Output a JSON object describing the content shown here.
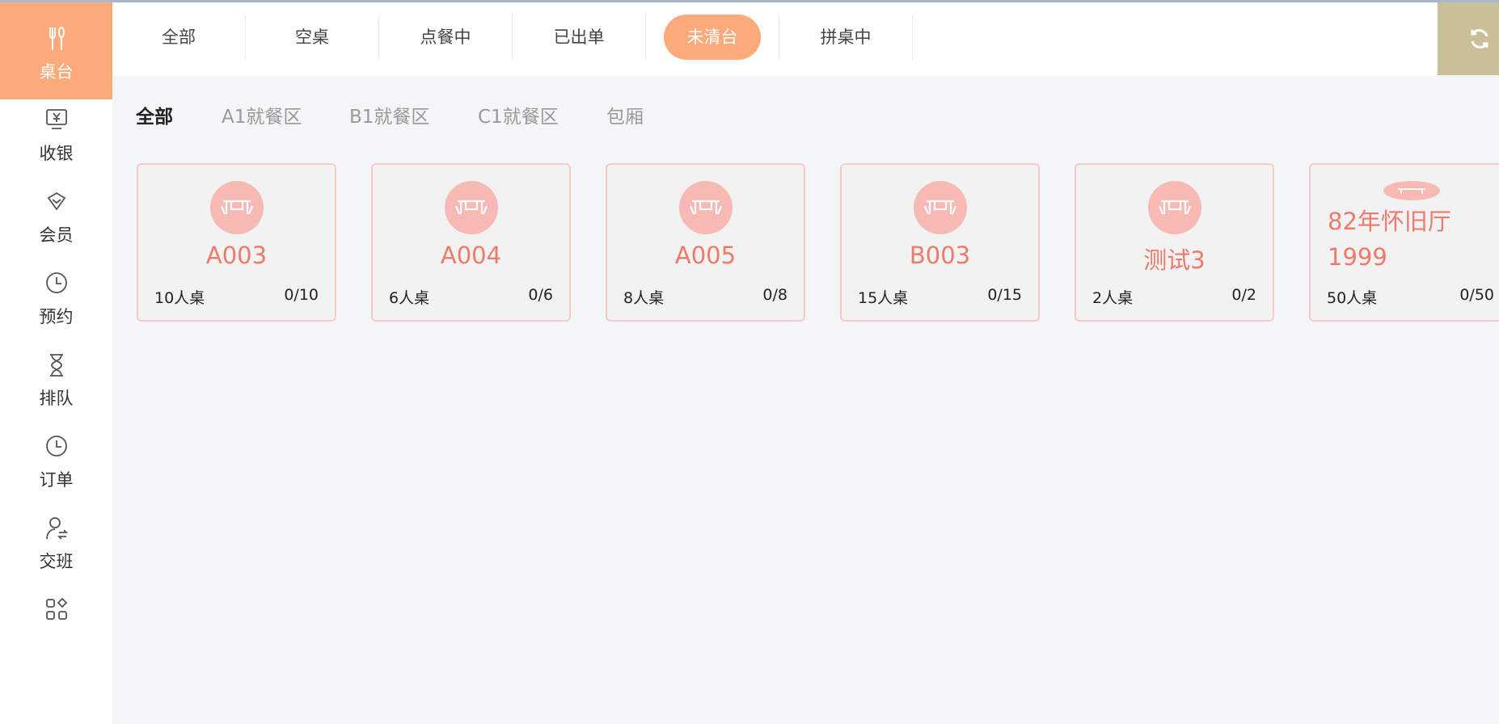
{
  "sidebar": {
    "items": [
      {
        "label": "桌台",
        "icon": "fork-knife-icon"
      },
      {
        "label": "收银",
        "icon": "cashier-icon"
      },
      {
        "label": "会员",
        "icon": "diamond-icon"
      },
      {
        "label": "预约",
        "icon": "clock-icon"
      },
      {
        "label": "排队",
        "icon": "hourglass-icon"
      },
      {
        "label": "订单",
        "icon": "clock-icon"
      },
      {
        "label": "交班",
        "icon": "user-swap-icon"
      },
      {
        "label": "",
        "icon": "apps-icon"
      }
    ]
  },
  "filters": [
    "全部",
    "空桌",
    "点餐中",
    "已出单",
    "未清台",
    "拼桌中"
  ],
  "active_filter": "未清台",
  "refresh_icon": "refresh-icon",
  "areas": [
    "全部",
    "A1就餐区",
    "B1就餐区",
    "C1就餐区",
    "包厢"
  ],
  "active_area": "全部",
  "tables": [
    {
      "name": "A003",
      "capacity": "10人桌",
      "occupancy": "0/10"
    },
    {
      "name": "A004",
      "capacity": "6人桌",
      "occupancy": "0/6"
    },
    {
      "name": "A005",
      "capacity": "8人桌",
      "occupancy": "0/8"
    },
    {
      "name": "B003",
      "capacity": "15人桌",
      "occupancy": "0/15"
    },
    {
      "name": "测试3",
      "capacity": "2人桌",
      "occupancy": "0/2"
    },
    {
      "name": "82年怀旧厅1999",
      "capacity": "50人桌",
      "occupancy": "0/50"
    }
  ],
  "colors": {
    "accent": "#fdaa7a",
    "table_name": "#f07a6a",
    "card_border": "#f8c9c6",
    "refresh_bg": "#c9bf99"
  }
}
